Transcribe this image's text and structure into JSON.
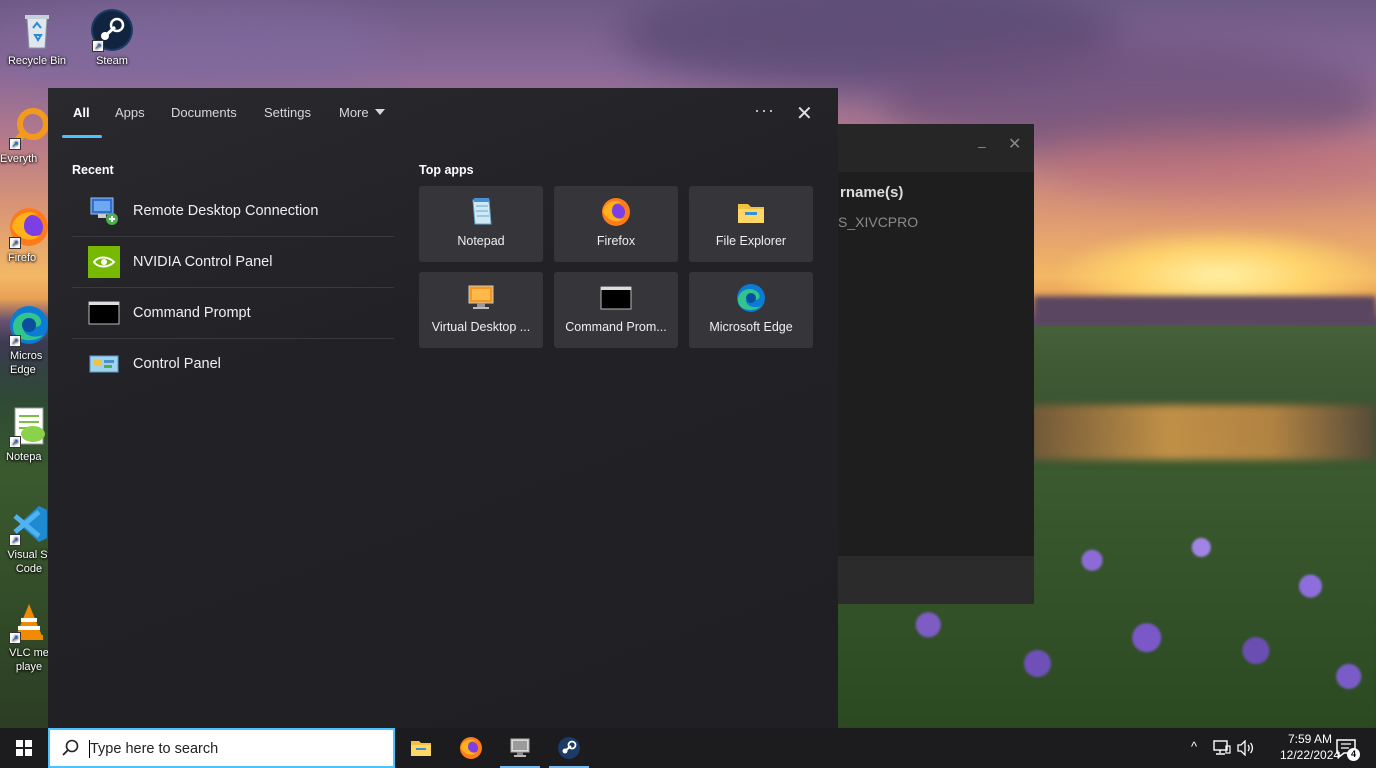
{
  "desktop": {
    "icons": [
      {
        "label": "Recycle Bin",
        "icon": "recycle-bin-icon"
      },
      {
        "label": "Steam",
        "icon": "steam-icon"
      },
      {
        "label": "Everyth",
        "icon": "everything-search-icon"
      },
      {
        "label": "Firefo",
        "icon": "firefox-icon"
      },
      {
        "label": "Micros\nEdge",
        "icon": "edge-icon"
      },
      {
        "label": "Notepa",
        "icon": "notepad-plus-icon"
      },
      {
        "label": "Visual St\nCode",
        "icon": "vscode-icon"
      },
      {
        "label": "VLC me\nplaye",
        "icon": "vlc-icon"
      }
    ]
  },
  "background_window": {
    "heading": "rname(s)",
    "value": "S_XIVCPRO",
    "minimize_glyph": "–",
    "close_glyph": "✕"
  },
  "search_panel": {
    "tabs": [
      {
        "label": "All",
        "active": true
      },
      {
        "label": "Apps",
        "active": false
      },
      {
        "label": "Documents",
        "active": false
      },
      {
        "label": "Settings",
        "active": false
      },
      {
        "label": "More",
        "active": false
      }
    ],
    "more_options_glyph": "···",
    "close_glyph": "✕",
    "recent": {
      "title": "Recent",
      "items": [
        {
          "label": "Remote Desktop Connection",
          "icon": "remote-desktop-icon"
        },
        {
          "label": "NVIDIA Control Panel",
          "icon": "nvidia-icon"
        },
        {
          "label": "Command Prompt",
          "icon": "command-prompt-icon"
        },
        {
          "label": "Control Panel",
          "icon": "control-panel-icon"
        }
      ]
    },
    "top_apps": {
      "title": "Top apps",
      "items": [
        {
          "label": "Notepad",
          "icon": "notepad-icon"
        },
        {
          "label": "Firefox",
          "icon": "firefox-icon"
        },
        {
          "label": "File Explorer",
          "icon": "file-explorer-icon"
        },
        {
          "label": "Virtual Desktop ...",
          "icon": "virtual-desktop-icon"
        },
        {
          "label": "Command Prom...",
          "icon": "command-prompt-icon"
        },
        {
          "label": "Microsoft Edge",
          "icon": "edge-icon"
        }
      ]
    }
  },
  "taskbar": {
    "search_placeholder": "Type here to search",
    "pinned": [
      {
        "name": "File Explorer",
        "icon": "file-explorer-icon",
        "running": false
      },
      {
        "name": "Firefox",
        "icon": "firefox-icon",
        "running": false
      },
      {
        "name": "Virtual Desktop",
        "icon": "virtual-desktop-icon",
        "running": true
      },
      {
        "name": "Steam",
        "icon": "steam-icon",
        "running": true
      }
    ],
    "tray": {
      "chevron": "^",
      "time": "7:59 AM",
      "date": "12/22/2024",
      "notification_count": "4"
    }
  },
  "colors": {
    "accent": "#4cc2ff",
    "panel_bg": "#232327",
    "tile_bg": "#35353a",
    "taskbar_bg": "#1c1c1e"
  }
}
